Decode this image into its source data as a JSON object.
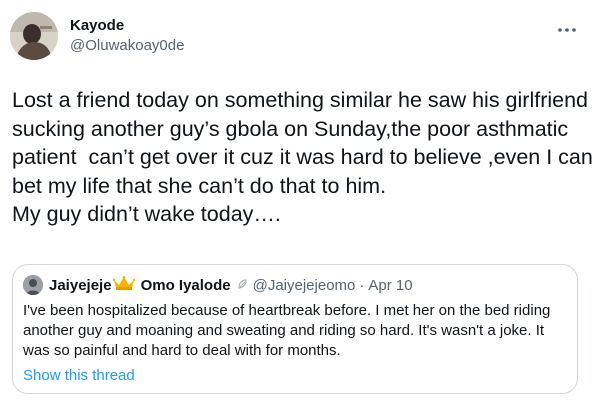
{
  "author": {
    "display_name": "Kayode",
    "handle": "@Oluwakoay0de"
  },
  "tweet": {
    "text": "Lost a friend today on something similar he saw his girlfriend sucking another guy’s gbola on Sunday,the poor asthmatic patient  can’t get over it cuz it was hard to believe ,even I can bet my life that she can’t do that to him.\nMy guy didn’t wake today…."
  },
  "quote": {
    "name": "Jaiyejeje",
    "name_suffix": "Omo Iyalode",
    "handle": "@Jaiyejejeomo",
    "separator": "·",
    "date": "Apr 10",
    "text": "I've been hospitalized because of heartbreak before. I met her on the bed  riding another guy and moaning and sweating and riding so hard. It's wasn't a joke. It was so painful and hard to deal with for months.",
    "show_thread": "Show this thread"
  },
  "icons": {
    "more": "more-dots-icon",
    "crown": "crown-emoji-icon",
    "name_emoji": "small-emoji-icon"
  },
  "colors": {
    "link": "#1d9bf0",
    "secondary_text": "#536471",
    "border": "#cfd9de"
  }
}
